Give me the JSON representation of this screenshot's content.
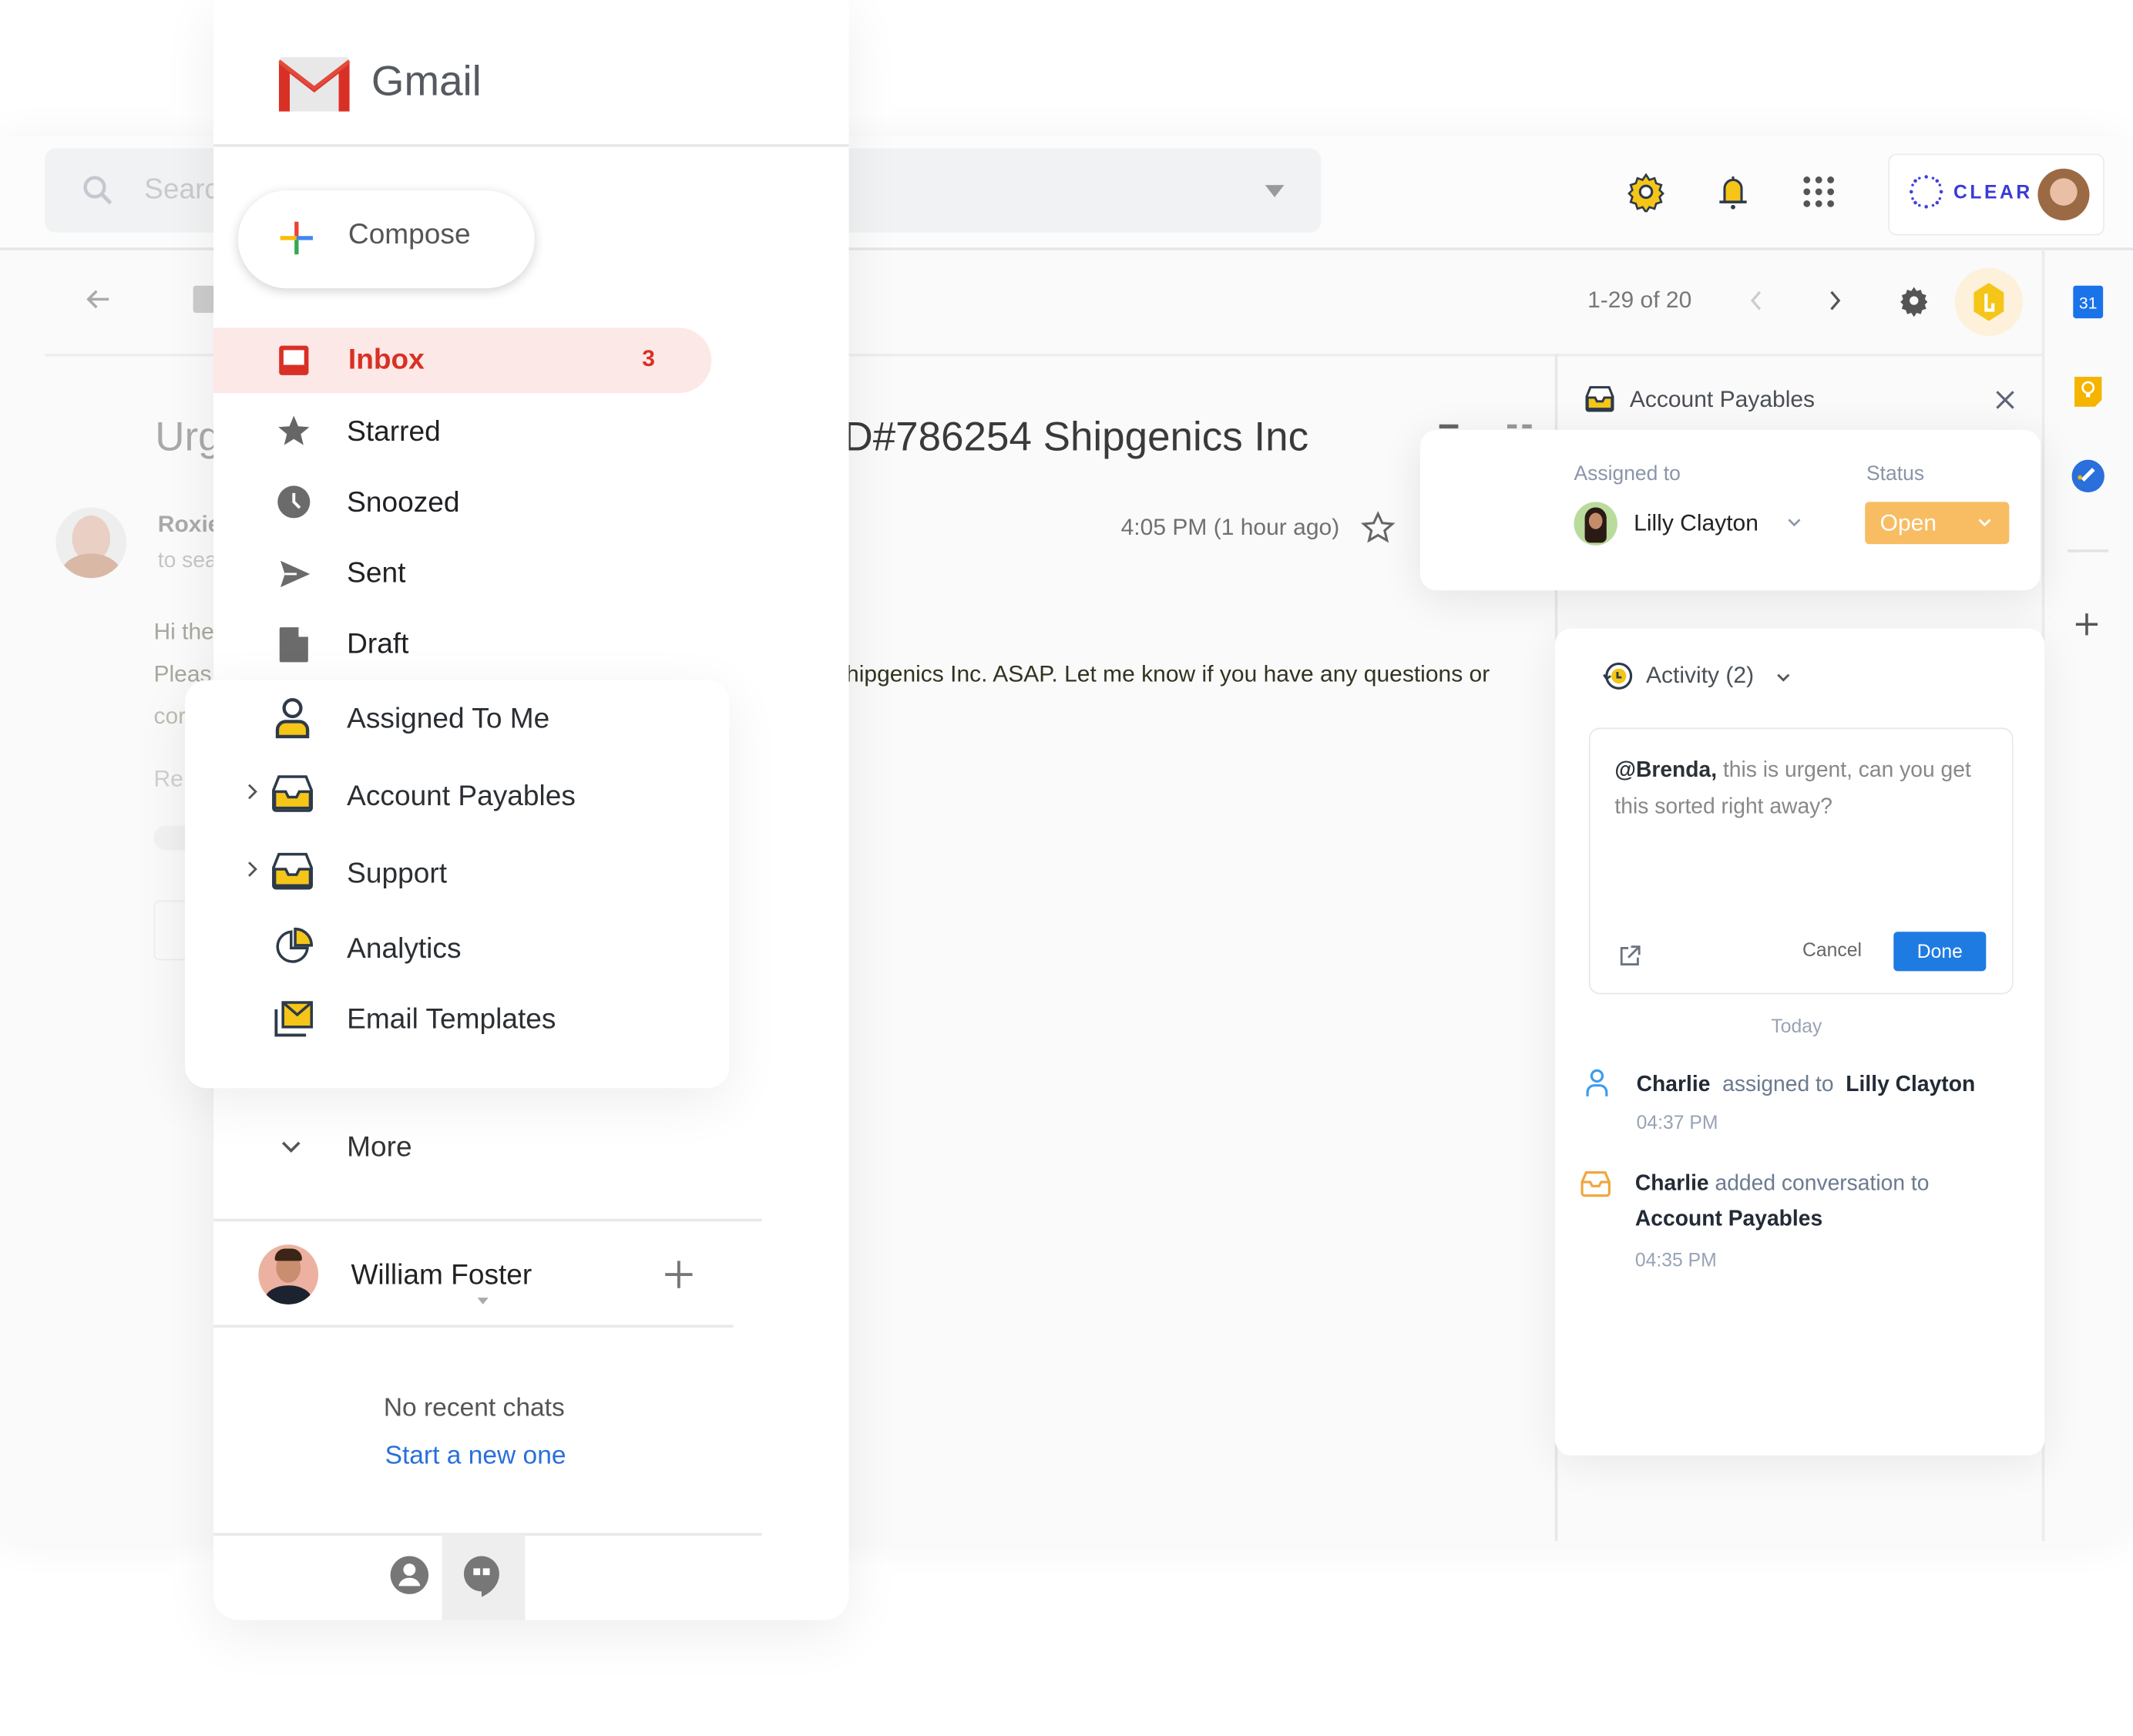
{
  "app": {
    "name": "Gmail",
    "brand_color": "#d93025"
  },
  "search": {
    "placeholder": "Search"
  },
  "topbar": {
    "icons": [
      "settings-gear-icon",
      "notification-bell-icon",
      "apps-grid-icon"
    ],
    "account_brand": "CLEAR"
  },
  "toolbar": {
    "pagination": "1-29 of 20"
  },
  "email": {
    "subject_left": "Urg",
    "subject_right": "D#786254 Shipgenics Inc",
    "sender": "Roxie",
    "to": "to sea",
    "timestamp": "4:05 PM (1 hour ago)",
    "body_line1": "Hi the",
    "body_line2": "Pleas",
    "body_line3": "cor",
    "body_line2_rest": "hipgenics Inc. ASAP. Let me know if you have any questions or",
    "reply": "Re"
  },
  "sidebar": {
    "compose_label": "Compose",
    "items": [
      {
        "label": "Inbox",
        "count": "3",
        "icon": "inbox-icon",
        "active": true
      },
      {
        "label": "Starred",
        "icon": "star-icon"
      },
      {
        "label": "Snoozed",
        "icon": "clock-icon"
      },
      {
        "label": "Sent",
        "icon": "send-icon"
      },
      {
        "label": "Draft",
        "icon": "draft-icon"
      },
      {
        "label": "Assigned To Me",
        "icon": "person-icon"
      },
      {
        "label": "Account Payables",
        "icon": "shared-inbox-icon",
        "expandable": true
      },
      {
        "label": "Support",
        "icon": "shared-inbox-icon",
        "expandable": true
      },
      {
        "label": "Analytics",
        "icon": "pie-chart-icon"
      },
      {
        "label": "Email Templates",
        "icon": "email-template-icon"
      }
    ],
    "more_label": "More",
    "chat_user": "William Foster",
    "no_chats": "No recent chats",
    "start_chat": "Start a new one"
  },
  "panel": {
    "title": "Account Payables",
    "assigned_label": "Assigned to",
    "assignee": "Lilly Clayton",
    "status_label": "Status",
    "status_value": "Open",
    "status_color": "#f8bd63",
    "activity_title": "Activity (2)",
    "comment_mention": "@Brenda,",
    "comment_text": " this is urgent, can you get this sorted right away?",
    "cancel_label": "Cancel",
    "done_label": "Done",
    "done_color": "#1e7be2",
    "date_header": "Today",
    "activities": [
      {
        "actor": "Charlie",
        "action": "assigned to",
        "target": "Lilly Clayton",
        "time": "04:37 PM"
      },
      {
        "actor": "Charlie",
        "action": "added conversation to",
        "target": "Account Payables",
        "time": "04:35 PM"
      }
    ]
  },
  "side_apps": {
    "calendar_day": "31"
  }
}
